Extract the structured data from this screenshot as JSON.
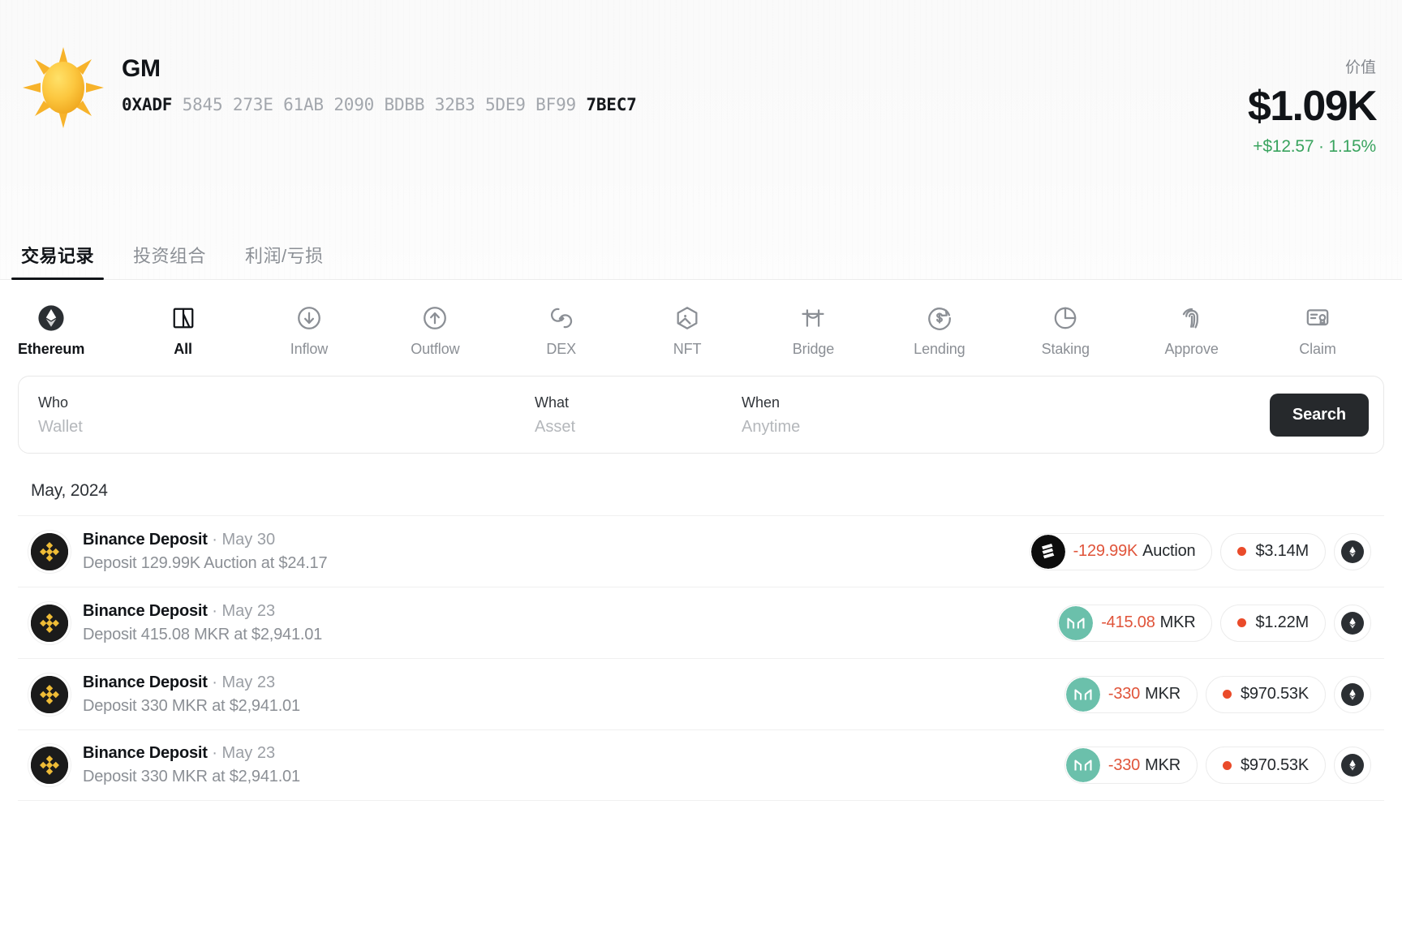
{
  "header": {
    "avatar_icon": "sun-emoji-avatar",
    "wallet_name": "GM",
    "address_prefix": "0XADF",
    "address_middle": "5845 273E 61AB 2090 BDBB 32B3 5DE9 BF99",
    "address_suffix": "7BEC7",
    "value_label": "价值",
    "value_amount": "$1.09K",
    "value_change": "+$12.57 · 1.15%",
    "change_color": "#3aa45f"
  },
  "tabs": [
    {
      "label": "交易记录",
      "active": true
    },
    {
      "label": "投资组合",
      "active": false
    },
    {
      "label": "利润/亏损",
      "active": false
    }
  ],
  "filters": [
    {
      "label": "Ethereum",
      "icon": "ethereum-icon",
      "active": true
    },
    {
      "label": "All",
      "icon": "all-icon",
      "active": true
    },
    {
      "label": "Inflow",
      "icon": "inflow-arrow-down-circle-icon",
      "active": false
    },
    {
      "label": "Outflow",
      "icon": "outflow-arrow-up-circle-icon",
      "active": false
    },
    {
      "label": "DEX",
      "icon": "dex-swap-icon",
      "active": false
    },
    {
      "label": "NFT",
      "icon": "nft-hexagon-image-icon",
      "active": false
    },
    {
      "label": "Bridge",
      "icon": "bridge-icon",
      "active": false
    },
    {
      "label": "Lending",
      "icon": "lending-dollar-refresh-icon",
      "active": false
    },
    {
      "label": "Staking",
      "icon": "staking-pie-icon",
      "active": false
    },
    {
      "label": "Approve",
      "icon": "approve-fingerprint-icon",
      "active": false
    },
    {
      "label": "Claim",
      "icon": "claim-certificate-icon",
      "active": false
    }
  ],
  "search": {
    "who_label": "Who",
    "who_placeholder": "Wallet",
    "what_label": "What",
    "what_placeholder": "Asset",
    "when_label": "When",
    "when_placeholder": "Anytime",
    "button_label": "Search"
  },
  "list": {
    "month_header": "May, 2024",
    "rows": [
      {
        "source_icon": "binance-icon",
        "title": "Binance Deposit",
        "date": "· May 30",
        "subtitle": "Deposit 129.99K Auction at $24.17",
        "token_icon": "auction-token-icon",
        "token_color": "#0d0d0d",
        "amount": "-129.99K",
        "symbol": "Auction",
        "usd": "$3.14M",
        "chain_icon": "ethereum-icon"
      },
      {
        "source_icon": "binance-icon",
        "title": "Binance Deposit",
        "date": "· May 23",
        "subtitle": "Deposit 415.08 MKR at $2,941.01",
        "token_icon": "maker-mkr-token-icon",
        "token_color": "#6bc0ab",
        "amount": "-415.08",
        "symbol": "MKR",
        "usd": "$1.22M",
        "chain_icon": "ethereum-icon"
      },
      {
        "source_icon": "binance-icon",
        "title": "Binance Deposit",
        "date": "· May 23",
        "subtitle": "Deposit 330 MKR at $2,941.01",
        "token_icon": "maker-mkr-token-icon",
        "token_color": "#6bc0ab",
        "amount": "-330",
        "symbol": "MKR",
        "usd": "$970.53K",
        "chain_icon": "ethereum-icon"
      },
      {
        "source_icon": "binance-icon",
        "title": "Binance Deposit",
        "date": "· May 23",
        "subtitle": "Deposit 330 MKR at $2,941.01",
        "token_icon": "maker-mkr-token-icon",
        "token_color": "#6bc0ab",
        "amount": "-330",
        "symbol": "MKR",
        "usd": "$970.53K",
        "chain_icon": "ethereum-icon"
      }
    ]
  }
}
